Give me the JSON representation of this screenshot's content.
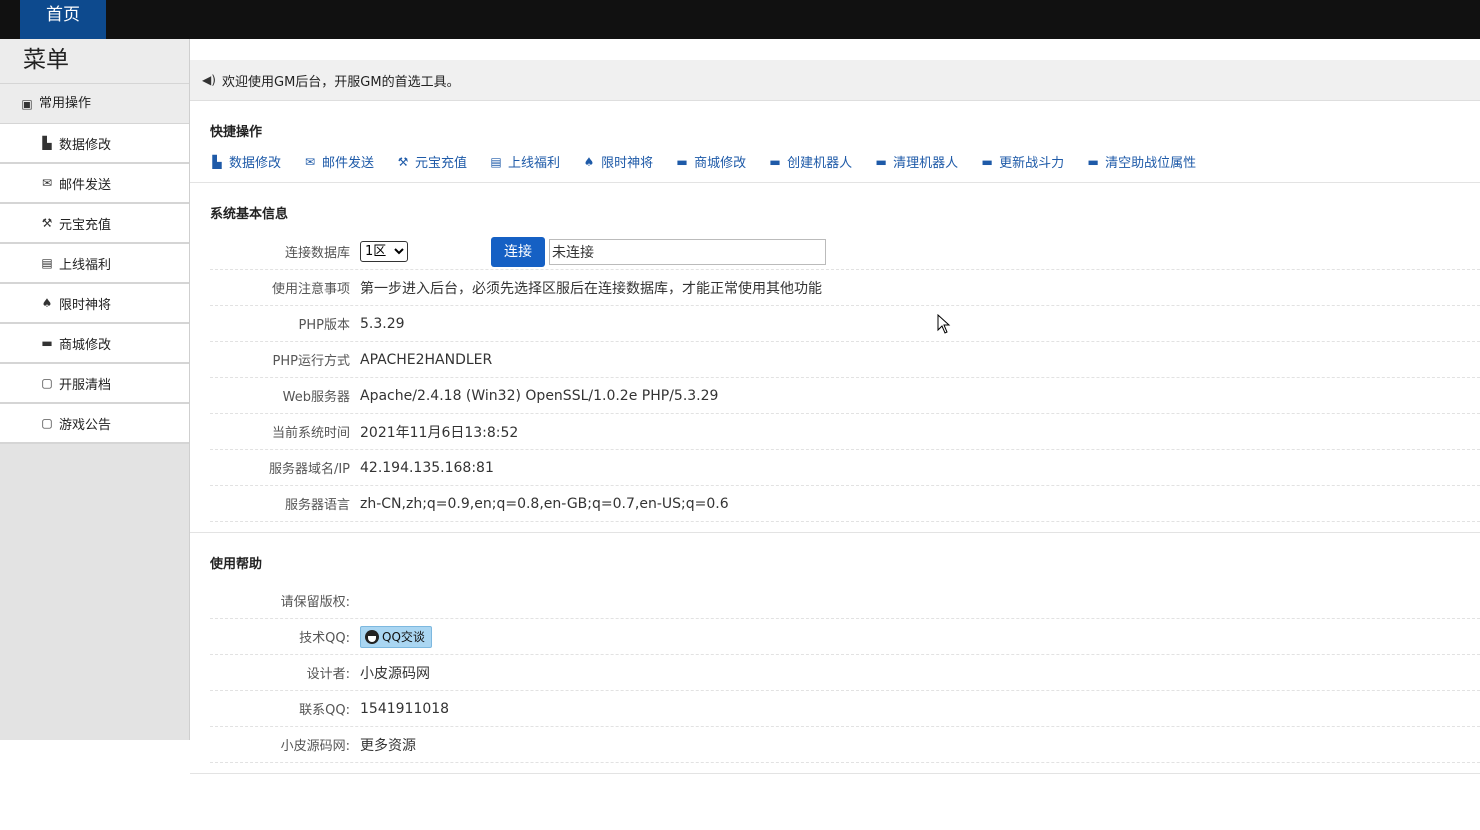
{
  "topbar": {
    "home_tab": "首页"
  },
  "sidebar": {
    "title": "菜单",
    "group_label": "常用操作",
    "items": [
      {
        "label": "数据修改",
        "icon": "chart-icon"
      },
      {
        "label": "邮件发送",
        "icon": "envelope-icon"
      },
      {
        "label": "元宝充值",
        "icon": "wrench-icon"
      },
      {
        "label": "上线福利",
        "icon": "list-icon"
      },
      {
        "label": "限时神将",
        "icon": "spade-icon"
      },
      {
        "label": "商城修改",
        "icon": "folder-icon"
      },
      {
        "label": "开服清档",
        "icon": "file-icon"
      },
      {
        "label": "游戏公告",
        "icon": "file-icon"
      }
    ]
  },
  "notice": {
    "text": "欢迎使用GM后台，开服GM的首选工具。"
  },
  "quick": {
    "title": "快捷操作",
    "links": [
      {
        "label": "数据修改",
        "icon": "chart-icon"
      },
      {
        "label": "邮件发送",
        "icon": "envelope-icon"
      },
      {
        "label": "元宝充值",
        "icon": "wrench-icon"
      },
      {
        "label": "上线福利",
        "icon": "list-icon"
      },
      {
        "label": "限时神将",
        "icon": "spade-icon"
      },
      {
        "label": "商城修改",
        "icon": "folder-icon"
      },
      {
        "label": "创建机器人",
        "icon": "folder-icon"
      },
      {
        "label": "清理机器人",
        "icon": "folder-icon"
      },
      {
        "label": "更新战斗力",
        "icon": "folder-icon"
      },
      {
        "label": "清空助战位属性",
        "icon": "folder-icon"
      }
    ]
  },
  "sysinfo": {
    "title": "系统基本信息",
    "db_label": "连接数据库",
    "db_selected": "1区",
    "connect_label": "连接",
    "status_value": "未连接",
    "rows": [
      {
        "label": "使用注意事项",
        "value": "第一步进入后台，必须先选择区服后在连接数据库，才能正常使用其他功能"
      },
      {
        "label": "PHP版本",
        "value": "5.3.29"
      },
      {
        "label": "PHP运行方式",
        "value": "APACHE2HANDLER"
      },
      {
        "label": "Web服务器",
        "value": "Apache/2.4.18 (Win32) OpenSSL/1.0.2e PHP/5.3.29"
      },
      {
        "label": "当前系统时间",
        "value": "2021年11月6日13:8:52"
      },
      {
        "label": "服务器域名/IP",
        "value": "42.194.135.168:81"
      },
      {
        "label": "服务器语言",
        "value": "zh-CN,zh;q=0.9,en;q=0.8,en-GB;q=0.7,en-US;q=0.6"
      }
    ]
  },
  "help": {
    "title": "使用帮助",
    "copyright_label": "请保留版权:",
    "tech_qq_label": "技术QQ:",
    "qq_button": "QQ交谈",
    "designer_label": "设计者:",
    "designer_value": "小皮源码网",
    "contact_label": "联系QQ:",
    "contact_value": "1541911018",
    "site_label": "小皮源码网:",
    "site_link": "更多资源"
  }
}
